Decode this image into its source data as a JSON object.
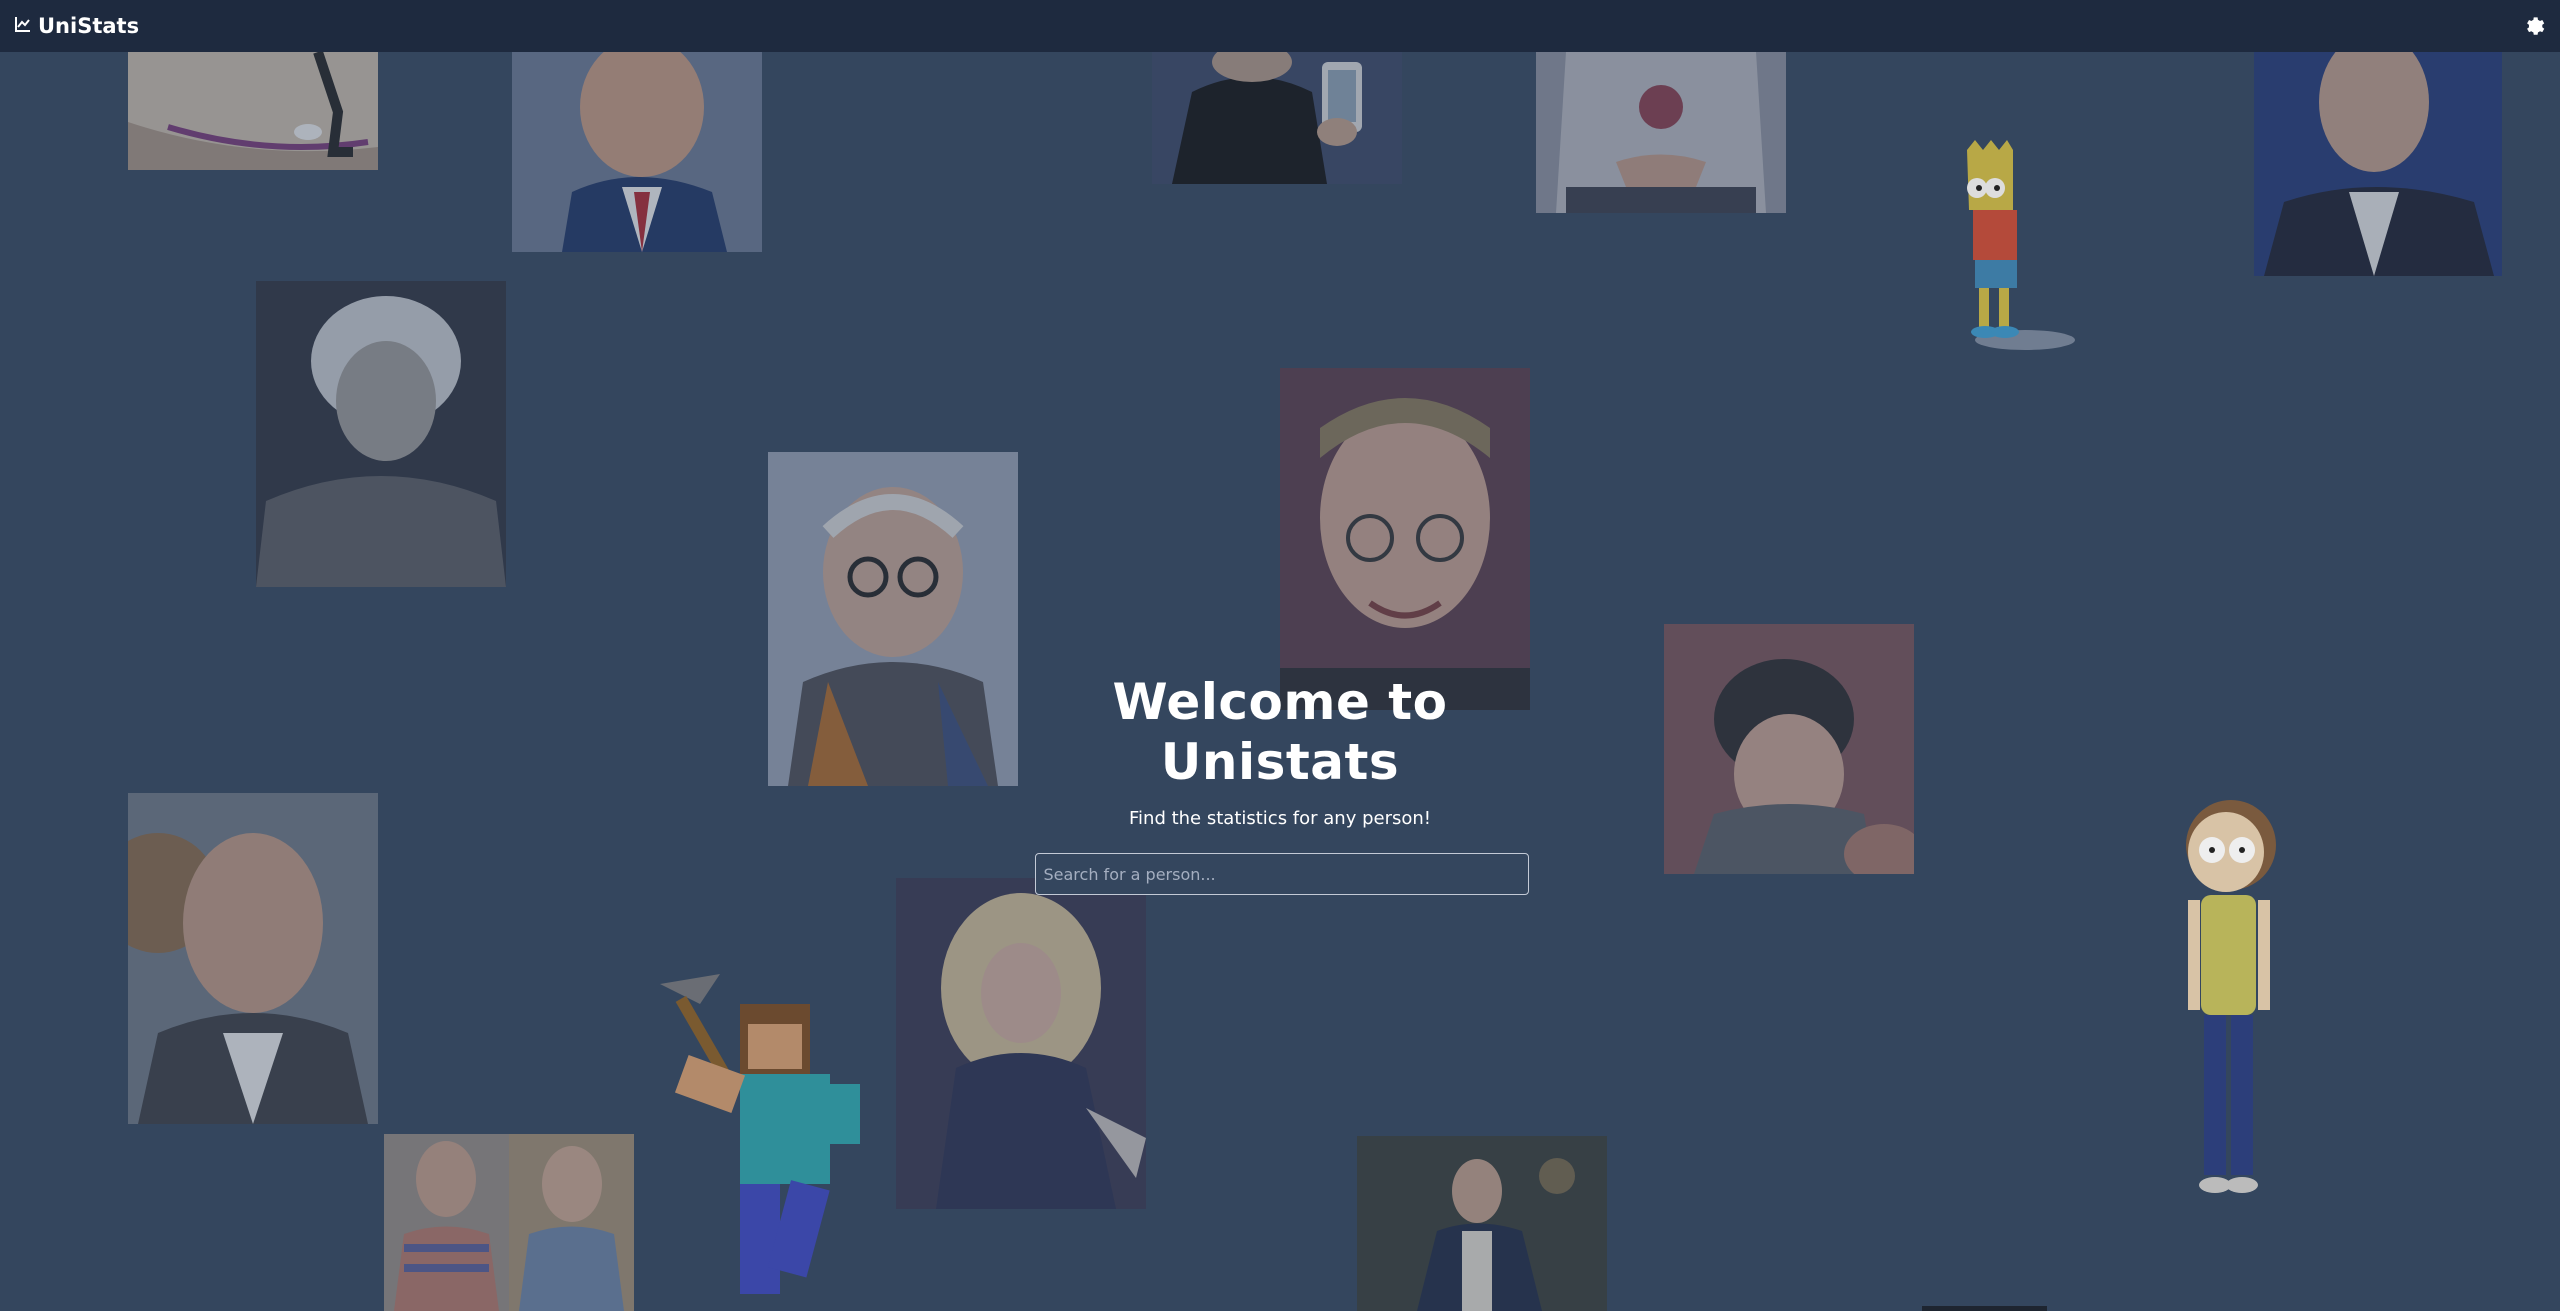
{
  "app": {
    "title": "UniStats"
  },
  "header": {
    "logo_icon": "chart-line-icon",
    "settings_icon": "gear-icon"
  },
  "hero": {
    "title": "Welcome to Unistats",
    "subtitle": "Find the statistics for any person!",
    "search": {
      "placeholder": "Search for a person...",
      "value": ""
    }
  },
  "colors": {
    "background": "#34465e",
    "topbar": "#1e2a3f",
    "text": "#ffffff"
  }
}
